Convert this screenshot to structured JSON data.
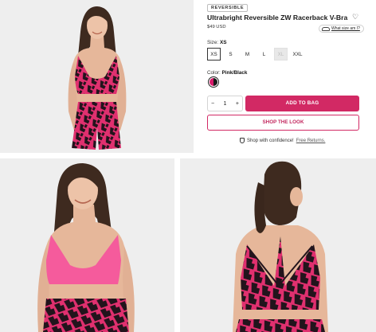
{
  "product": {
    "badge": "REVERSIBLE",
    "title": "Ultrabright Reversible ZW Racerback V-Bra",
    "price": "$49 USD",
    "size_guide": "What size am I?",
    "size_label": "Size:",
    "selected_size": "XS",
    "sizes": [
      {
        "label": "XS",
        "state": "selected"
      },
      {
        "label": "S",
        "state": "available"
      },
      {
        "label": "M",
        "state": "available"
      },
      {
        "label": "L",
        "state": "available"
      },
      {
        "label": "XL",
        "state": "unavailable"
      },
      {
        "label": "XXL",
        "state": "available"
      }
    ],
    "color_label": "Color:",
    "selected_color": "Pink/Black",
    "swatch_colors": [
      "#d81b6b",
      "#1a1a1a"
    ],
    "quantity": "1",
    "qty_minus": "−",
    "qty_plus": "+",
    "add_to_bag": "ADD TO BAG",
    "shop_the_look": "SHOP THE LOOK",
    "confidence_text": "Shop with confidence!",
    "free_returns": "Free Returns."
  },
  "icons": {
    "wishlist": "heart-icon",
    "size_guide": "ruler-icon",
    "confidence": "shield-icon"
  },
  "colors": {
    "accent": "#d22964",
    "print_pink": "#e0306f",
    "solid_pink": "#f55b9c",
    "print_dark": "#22141c"
  }
}
